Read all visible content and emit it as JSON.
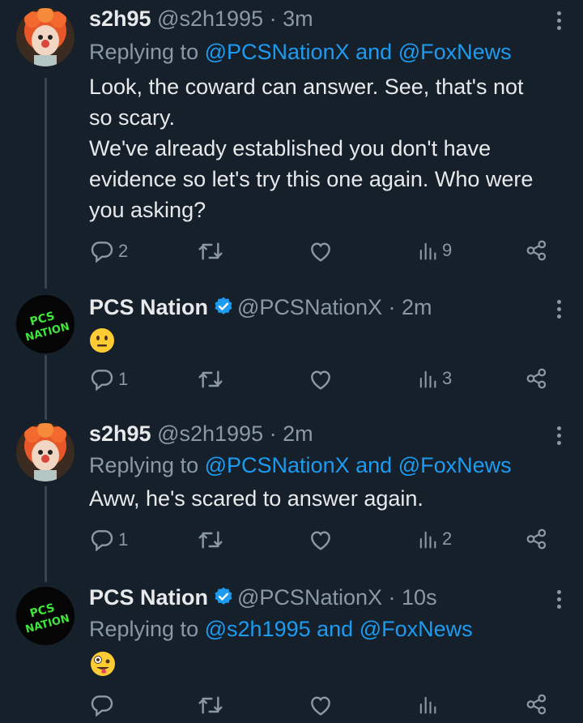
{
  "tweets": [
    {
      "name": "s2h95",
      "handle": "@s2h1995",
      "sep": "·",
      "time": "3m",
      "replying_prefix": "Replying to",
      "mention1": "@PCSNationX",
      "and": "and",
      "mention2": "@FoxNews",
      "lines": [
        "Look, the coward can answer. See, that's not",
        "so scary.",
        "We've already established you don't have",
        "evidence so let's try this one again. Who were",
        "you asking?"
      ],
      "replies": "2",
      "views": "9"
    },
    {
      "name": "PCS Nation",
      "handle": "@PCSNationX",
      "sep": "·",
      "time": "2m",
      "emoji": "neutral-face-emoji",
      "replies": "1",
      "views": "3"
    },
    {
      "name": "s2h95",
      "handle": "@s2h1995",
      "sep": "·",
      "time": "2m",
      "replying_prefix": "Replying to",
      "mention1": "@PCSNationX",
      "and": "and",
      "mention2": "@FoxNews",
      "lines": [
        "Aww, he's scared to answer again."
      ],
      "replies": "1",
      "views": "2"
    },
    {
      "name": "PCS Nation",
      "handle": "@PCSNationX",
      "sep": "·",
      "time": "10s",
      "replying_prefix": "Replying to",
      "mention1": "@s2h1995",
      "and": "and",
      "mention2": "@FoxNews",
      "emoji": "zany-face-emoji"
    }
  ],
  "avatar_text": "PCS NATION",
  "colors": {
    "background": "#15202b",
    "accent": "#1d9bf0",
    "muted": "#8b98a5",
    "verified": "#1d9bf0"
  }
}
